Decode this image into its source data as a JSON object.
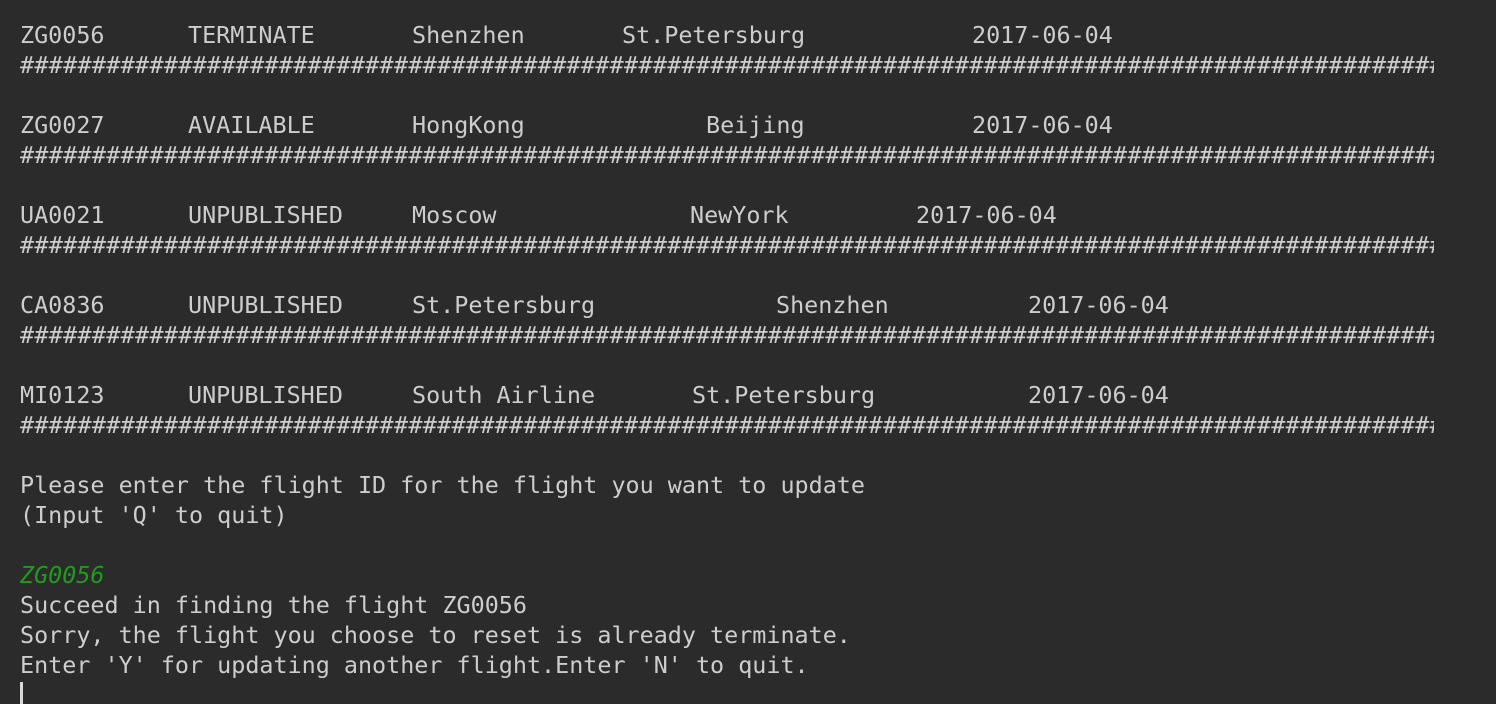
{
  "console": {
    "flights": [
      {
        "id": "ZG0056",
        "status": "TERMINATE",
        "from": "Shenzhen",
        "to": "St.Petersburg",
        "date": "2017-06-04"
      },
      {
        "id": "ZG0027",
        "status": "AVAILABLE",
        "from": "HongKong",
        "to": "Beijing",
        "date": "2017-06-04"
      },
      {
        "id": "UA0021",
        "status": "UNPUBLISHED",
        "from": "Moscow",
        "to": "NewYork",
        "date": "2017-06-04"
      },
      {
        "id": "CA0836",
        "status": "UNPUBLISHED",
        "from": "St.Petersburg",
        "to": "Shenzhen",
        "date": "2017-06-04"
      },
      {
        "id": "MI0123",
        "status": "UNPUBLISHED",
        "from": "South Airline",
        "to": "St.Petersburg",
        "date": "2017-06-04"
      }
    ],
    "separator": "############################################################################################################################",
    "prompt_line1": "Please enter the flight ID for the flight you want to update",
    "prompt_line2": "(Input 'Q' to quit)",
    "user_input": "ZG0056",
    "result_line1": "Succeed in finding the flight ZG0056",
    "result_line2": "Sorry, the flight you choose to reset is already terminate.",
    "result_line3": "Enter 'Y' for updating another flight.Enter 'N' to quit.",
    "colors": {
      "background": "#2b2b2b",
      "text": "#cdcdcd",
      "user_input": "#1f9b1f"
    }
  }
}
